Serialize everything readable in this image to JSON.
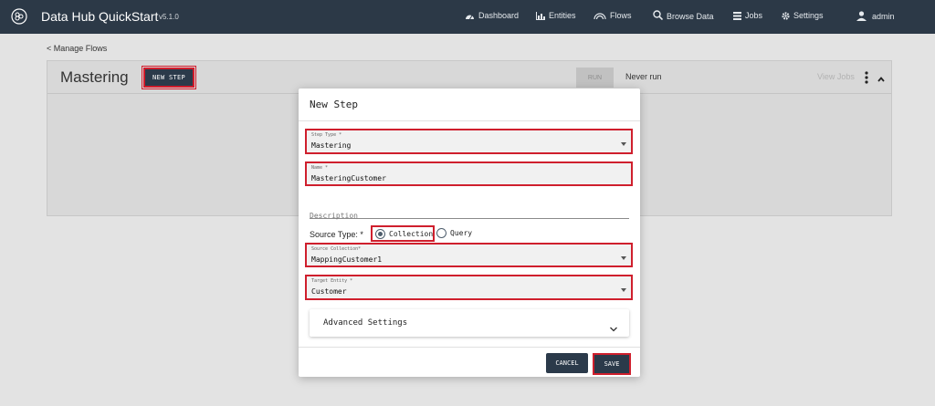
{
  "colors": {
    "topbar": "#2c3947",
    "button_dark": "#2b3a4a",
    "highlight_red": "#cf1f2d",
    "backdrop": "#e3e3e3"
  },
  "topbar": {
    "logo_icon": "datahub-logo-icon",
    "title": "Data Hub QuickStart",
    "version": "v5.1.0",
    "nav": [
      {
        "label": "Dashboard",
        "icon": "speedometer-icon"
      },
      {
        "label": "Entities",
        "icon": "bar-chart-icon"
      },
      {
        "label": "Flows",
        "icon": "rainbow-icon"
      },
      {
        "label": "Browse Data",
        "icon": "search-icon"
      },
      {
        "label": "Jobs",
        "icon": "list-icon"
      },
      {
        "label": "Settings",
        "icon": "gear-icon"
      }
    ],
    "user": {
      "label": "admin",
      "icon": "user-icon"
    }
  },
  "breadcrumb": {
    "back_label": "< Manage Flows"
  },
  "flow": {
    "title": "Mastering",
    "new_step_label": "NEW STEP",
    "run_label": "RUN",
    "status": "Never run",
    "view_jobs_label": "View Jobs"
  },
  "modal": {
    "title": "New Step",
    "step_type": {
      "label": "Step Type *",
      "value": "Mastering"
    },
    "name": {
      "label": "Name *",
      "value": "MasteringCustomer"
    },
    "description": {
      "label": "Description",
      "value": ""
    },
    "source_type": {
      "label": "Source Type: *",
      "options": [
        "Collection",
        "Query"
      ],
      "selected": "Collection"
    },
    "source_collection": {
      "label": "Source Collection*",
      "value": "MappingCustomer1"
    },
    "target_entity": {
      "label": "Target Entity *",
      "value": "Customer"
    },
    "advanced_label": "Advanced Settings",
    "cancel_label": "CANCEL",
    "save_label": "SAVE"
  }
}
